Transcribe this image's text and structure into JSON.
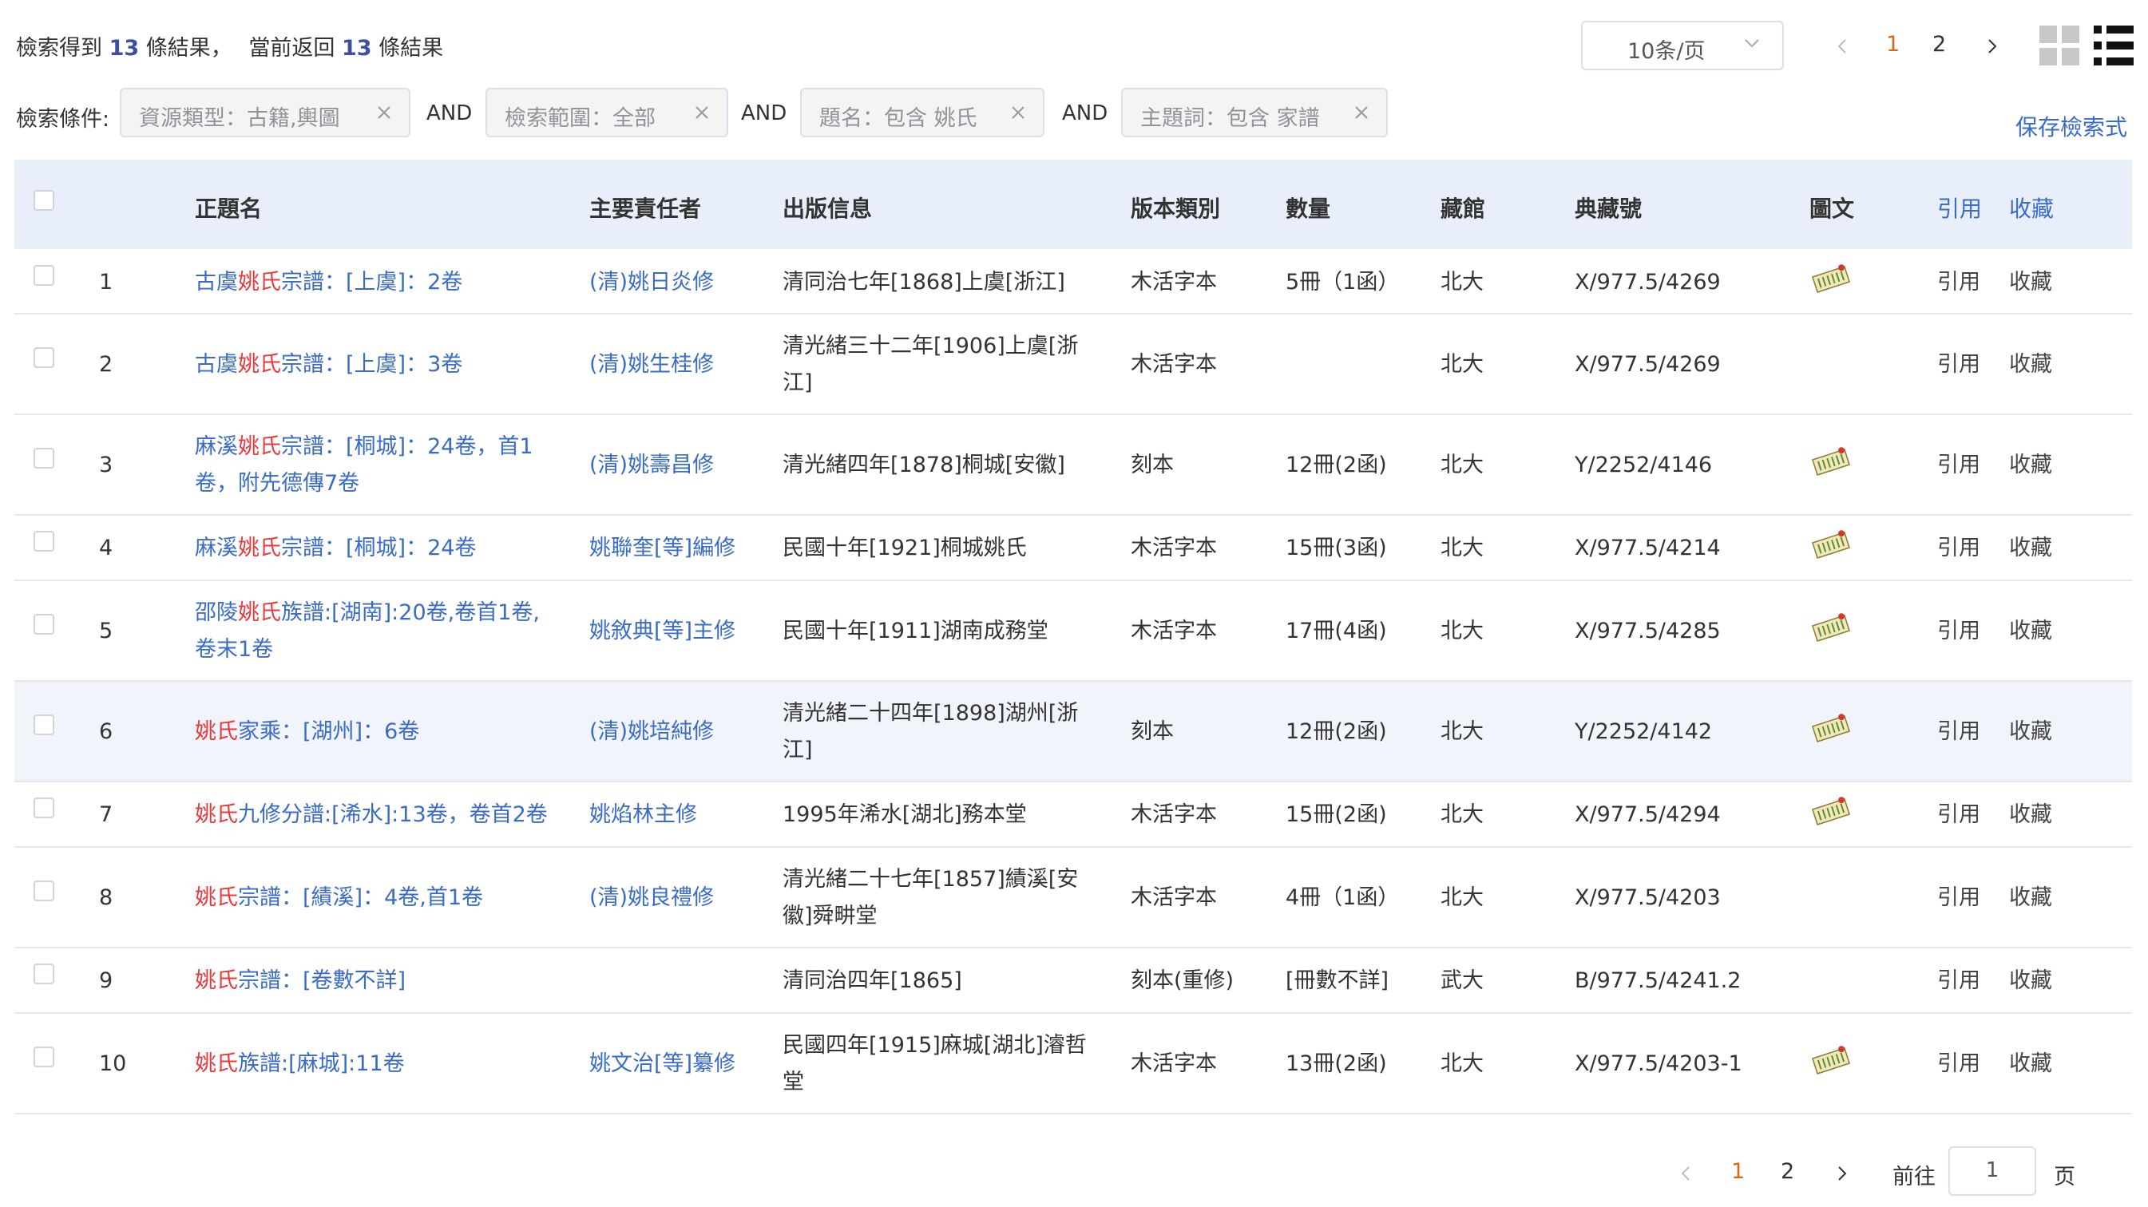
{
  "summary": {
    "part1": "檢索得到",
    "found": "13",
    "part2": "條結果，",
    "part3": "當前返回",
    "returned": "13",
    "part4": "條結果"
  },
  "pager_top": {
    "page_size": "10条/页",
    "pages": [
      "1",
      "2"
    ],
    "current": "1"
  },
  "conditions": {
    "label": "檢索條件:",
    "chips": [
      "資源類型：古籍,輿圖",
      "檢索範圍：全部",
      "題名：包含 姚氏",
      "主題詞：包含 家譜"
    ],
    "connector": "AND",
    "save_link": "保存檢索式"
  },
  "table": {
    "headers": {
      "title": "正題名",
      "author": "主要責任者",
      "publication": "出版信息",
      "edition": "版本類別",
      "quantity": "數量",
      "library": "藏館",
      "callno": "典藏號",
      "image": "圖文",
      "cite": "引用",
      "collect": "收藏"
    },
    "rows": [
      {
        "no": "1",
        "t_pre": "古虞",
        "t_hit": "姚氏",
        "t_post": "宗譜：[上虞]：2卷",
        "t_line2": "",
        "author": "(清)姚日炎修",
        "pub1": "清同治七年[1868]上虞[浙江]",
        "pub2": "",
        "edition": "木活字本",
        "qty": "5冊（1函）",
        "lib": "北大",
        "callno": "X/977.5/4269",
        "img": true,
        "cite": "引用",
        "collect": "收藏"
      },
      {
        "no": "2",
        "t_pre": "古虞",
        "t_hit": "姚氏",
        "t_post": "宗譜：[上虞]：3卷",
        "t_line2": "",
        "author": "(清)姚生桂修",
        "pub1": "清光緒三十二年[1906]上虞[浙",
        "pub2": "江]",
        "edition": "木活字本",
        "qty": "",
        "lib": "北大",
        "callno": "X/977.5/4269",
        "img": false,
        "cite": "引用",
        "collect": "收藏"
      },
      {
        "no": "3",
        "t_pre": "麻溪",
        "t_hit": "姚氏",
        "t_post": "宗譜：[桐城]：24卷，首1",
        "t_line2": "卷，附先德傳7卷",
        "author": "(清)姚壽昌修",
        "pub1": "清光緒四年[1878]桐城[安徽]",
        "pub2": "",
        "edition": "刻本",
        "qty": "12冊(2函)",
        "lib": "北大",
        "callno": "Y/2252/4146",
        "img": true,
        "cite": "引用",
        "collect": "收藏"
      },
      {
        "no": "4",
        "t_pre": "麻溪",
        "t_hit": "姚氏",
        "t_post": "宗譜：[桐城]：24卷",
        "t_line2": "",
        "author": "姚聯奎[等]編修",
        "pub1": "民國十年[1921]桐城姚氏",
        "pub2": "",
        "edition": "木活字本",
        "qty": "15冊(3函)",
        "lib": "北大",
        "callno": "X/977.5/4214",
        "img": true,
        "cite": "引用",
        "collect": "收藏"
      },
      {
        "no": "5",
        "t_pre": "邵陵",
        "t_hit": "姚氏",
        "t_post": "族譜:[湖南]:20卷,卷首1卷,",
        "t_line2": "卷末1卷",
        "author": "姚敘典[等]主修",
        "pub1": "民國十年[1911]湖南成務堂",
        "pub2": "",
        "edition": "木活字本",
        "qty": "17冊(4函)",
        "lib": "北大",
        "callno": "X/977.5/4285",
        "img": true,
        "cite": "引用",
        "collect": "收藏"
      },
      {
        "no": "6",
        "t_pre": "",
        "t_hit": "姚氏",
        "t_post": "家乘：[湖州]：6卷",
        "t_line2": "",
        "author": "(清)姚培純修",
        "pub1": "清光緒二十四年[1898]湖州[浙",
        "pub2": "江]",
        "edition": "刻本",
        "qty": "12冊(2函)",
        "lib": "北大",
        "callno": "Y/2252/4142",
        "img": true,
        "cite": "引用",
        "collect": "收藏"
      },
      {
        "no": "7",
        "t_pre": "",
        "t_hit": "姚氏",
        "t_post": "九修分譜:[浠水]:13卷，卷首2卷",
        "t_line2": "",
        "author": "姚焰林主修",
        "pub1": "1995年浠水[湖北]務本堂",
        "pub2": "",
        "edition": "木活字本",
        "qty": "15冊(2函)",
        "lib": "北大",
        "callno": "X/977.5/4294",
        "img": true,
        "cite": "引用",
        "collect": "收藏"
      },
      {
        "no": "8",
        "t_pre": "",
        "t_hit": "姚氏",
        "t_post": "宗譜：[績溪]：4卷,首1卷",
        "t_line2": "",
        "author": "(清)姚良禮修",
        "pub1": "清光緒二十七年[1857]績溪[安",
        "pub2": "徽]舜畊堂",
        "edition": "木活字本",
        "qty": "4冊（1函）",
        "lib": "北大",
        "callno": "X/977.5/4203",
        "img": false,
        "cite": "引用",
        "collect": "收藏"
      },
      {
        "no": "9",
        "t_pre": "",
        "t_hit": "姚氏",
        "t_post": "宗譜：[卷數不詳]",
        "t_line2": "",
        "author": "",
        "pub1": "清同治四年[1865]",
        "pub2": "",
        "edition": "刻本(重修)",
        "qty": "[冊數不詳]",
        "lib": "武大",
        "callno": "B/977.5/4241.2",
        "img": false,
        "cite": "引用",
        "collect": "收藏"
      },
      {
        "no": "10",
        "t_pre": "",
        "t_hit": "姚氏",
        "t_post": "族譜:[麻城]:11卷",
        "t_line2": "",
        "author": "姚文治[等]纂修",
        "pub1": "民國四年[1915]麻城[湖北]濬哲",
        "pub2": "堂",
        "edition": "木活字本",
        "qty": "13冊(2函)",
        "lib": "北大",
        "callno": "X/977.5/4203-1",
        "img": true,
        "cite": "引用",
        "collect": "收藏"
      }
    ]
  },
  "pager_bottom": {
    "pages": [
      "1",
      "2"
    ],
    "current": "1",
    "goto_label": "前往",
    "goto_value": "1",
    "page_suffix": "页"
  },
  "colors": {
    "link": "#3a6cc7",
    "hit": "#e8383b",
    "active_page": "#d2691e",
    "header_bg": "#e8effa"
  }
}
